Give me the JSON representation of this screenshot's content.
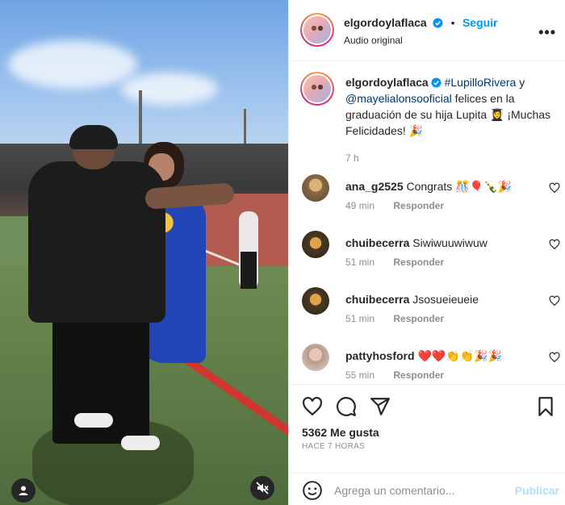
{
  "post": {
    "username": "elgordoylaflaca",
    "follow_label": "Seguir",
    "audio": "Audio original",
    "more_icon": "more-horizontal-icon"
  },
  "caption": {
    "username": "elgordoylaflaca",
    "mention1": "#LupilloRivera",
    "conj": " y",
    "mention2": "@mayelialonsooficial",
    "text": " felices en la graduación de su hija Lupita 👩‍🎓 ¡Muchas Felicidades! 🎉",
    "time": "7 h"
  },
  "comments": [
    {
      "username": "ana_g2525",
      "text": "Congrats 🎊🎈🍾🎉",
      "time": "49 min",
      "reply": "Responder"
    },
    {
      "username": "chuibecerra",
      "text": "Siwiwuuwiwuw",
      "time": "51 min",
      "reply": "Responder"
    },
    {
      "username": "chuibecerra",
      "text": "Jsosueieueie",
      "time": "51 min",
      "reply": "Responder"
    },
    {
      "username": "pattyhosford",
      "text": "❤️❤️👏👏🎉🎉",
      "time": "55 min",
      "reply": "Responder"
    }
  ],
  "actions": {
    "likes": "5362 Me gusta",
    "ago": "HACE 7 HORAS"
  },
  "composer": {
    "placeholder": "Agrega un comentario...",
    "post_label": "Publicar"
  },
  "colors": {
    "accent": "#0095f6",
    "verified": "#0095f6",
    "post_disabled": "#b2dffc"
  }
}
